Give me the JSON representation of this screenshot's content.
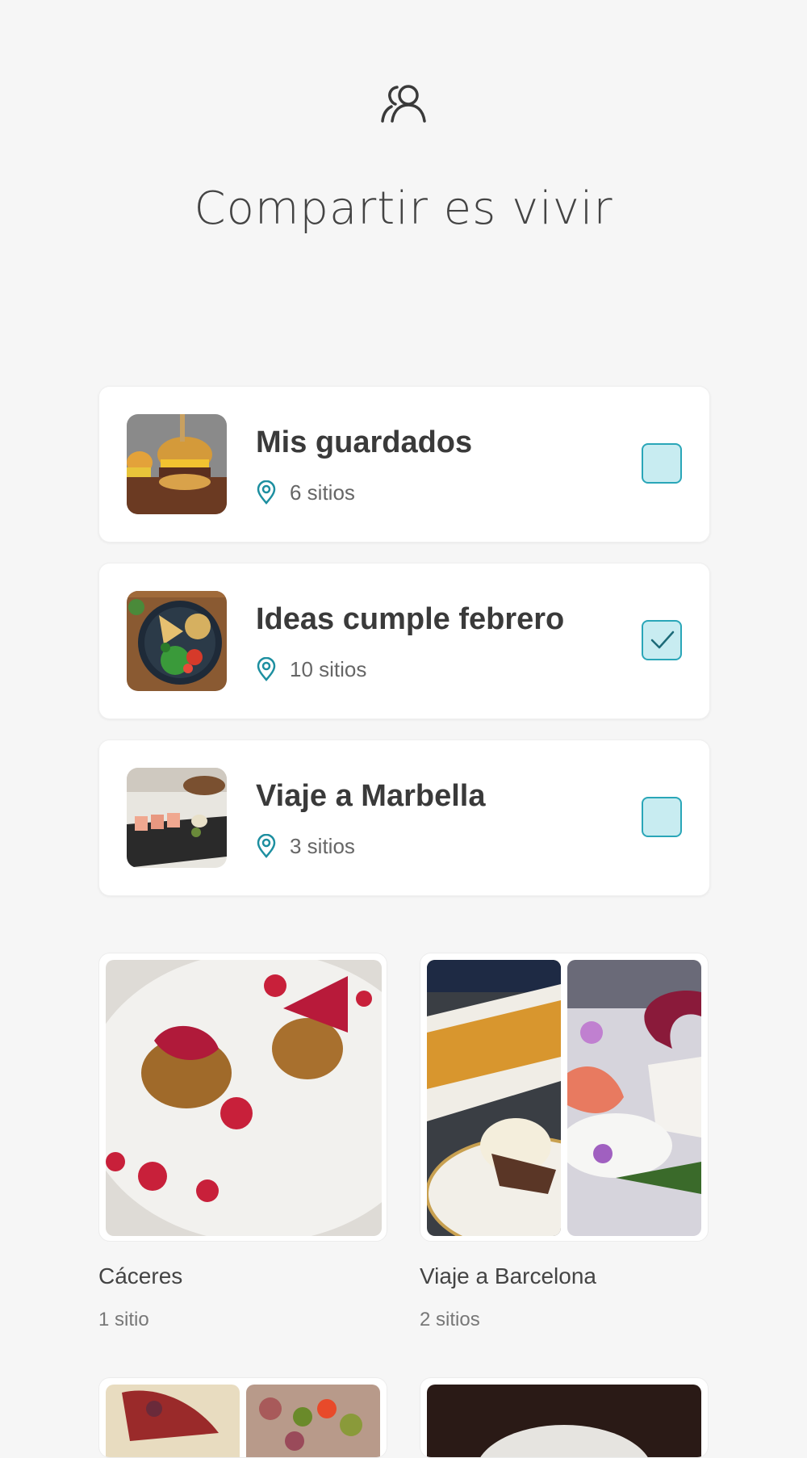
{
  "header": {
    "icon": "users-icon",
    "title": "Compartir es vivir"
  },
  "lists": [
    {
      "name": "Mis guardados",
      "count": "6 sitios",
      "checked": false,
      "image": "burger-photo"
    },
    {
      "name": "Ideas cumple febrero",
      "count": "10 sitios",
      "checked": true,
      "image": "bowl-salad-photo"
    },
    {
      "name": "Viaje a Marbella",
      "count": "3 sitios",
      "checked": false,
      "image": "sushi-photo"
    }
  ],
  "collections": [
    {
      "name": "Cáceres",
      "count": "1 sitio"
    },
    {
      "name": "Viaje a Barcelona",
      "count": "2 sitios"
    }
  ],
  "colors": {
    "accent": "#2aa6b8",
    "checkbox_fill": "#c8ecf1",
    "background": "#f6f6f6"
  }
}
